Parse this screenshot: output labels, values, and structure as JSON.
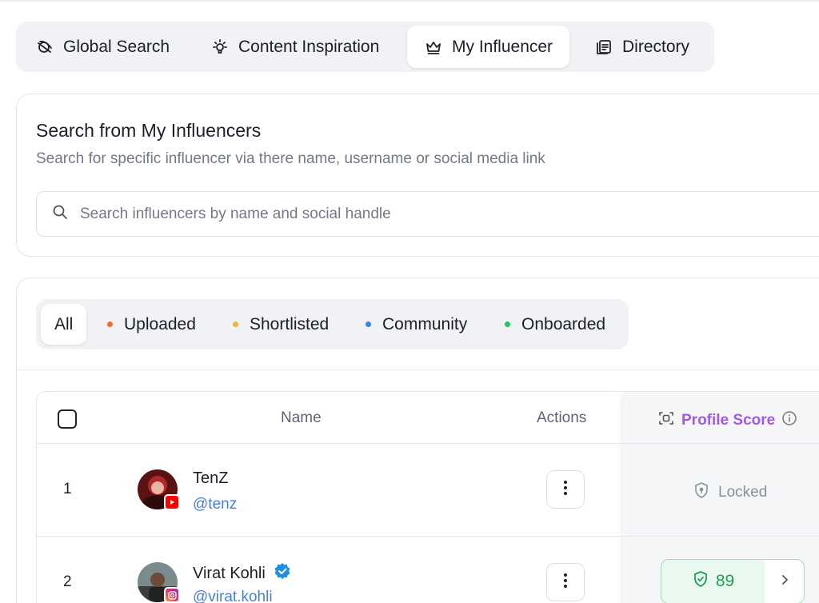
{
  "tabs": [
    {
      "label": "Global Search",
      "icon": "globe-search-icon",
      "active": false
    },
    {
      "label": "Content Inspiration",
      "icon": "lightbulb-icon",
      "active": false
    },
    {
      "label": "My Influencer",
      "icon": "crown-icon",
      "active": true
    },
    {
      "label": "Directory",
      "icon": "directory-icon",
      "active": false
    }
  ],
  "search": {
    "title": "Search from My Influencers",
    "subtitle": "Search for specific influencer via there name, username or social media link",
    "placeholder": "Search influencers by name and social handle",
    "value": ""
  },
  "filters": [
    {
      "label": "All",
      "active": true,
      "color": ""
    },
    {
      "label": "Uploaded",
      "active": false,
      "color": "#f26b2e"
    },
    {
      "label": "Shortlisted",
      "active": false,
      "color": "#f2b33d"
    },
    {
      "label": "Community",
      "active": false,
      "color": "#3b82f6"
    },
    {
      "label": "Onboarded",
      "active": false,
      "color": "#22c55e"
    }
  ],
  "table": {
    "headers": {
      "name": "Name",
      "actions": "Actions",
      "profile_score": "Profile Score"
    },
    "rows": [
      {
        "index": "1",
        "name": "TenZ",
        "handle": "@tenz",
        "platform": "youtube",
        "verified": false,
        "profile_score": {
          "locked": true,
          "label": "Locked"
        }
      },
      {
        "index": "2",
        "name": "Virat Kohli",
        "handle": "@virat.kohli",
        "platform": "instagram",
        "verified": true,
        "profile_score": {
          "locked": false,
          "value": "89"
        }
      }
    ]
  },
  "colors": {
    "accent_purple": "#a05ae6",
    "score_green": "#1e9e55",
    "link_blue": "#4a7fd6"
  }
}
